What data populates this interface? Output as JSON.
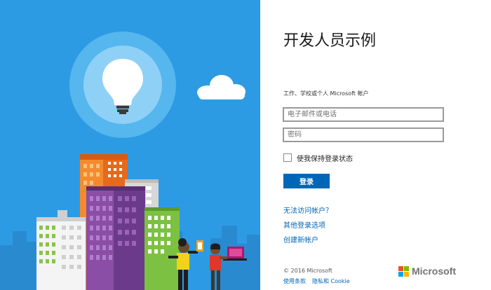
{
  "app": {
    "title": "开发人员示例"
  },
  "form": {
    "subtitle": "工作、学校或个人 Microsoft 帐户",
    "email_placeholder": "电子邮件或电话",
    "password_placeholder": "密码",
    "keep_signed_in_label": "使我保持登录状态",
    "sign_in_label": "登录"
  },
  "links": {
    "cant_access": "无法访问帐户？",
    "other_options": "其他登录选项",
    "create_account": "创建新帐户"
  },
  "footer": {
    "copyright": "© 2016 Microsoft",
    "terms": "使用条款",
    "privacy": "隐私和 Cookie",
    "logo_text": "Microsoft"
  },
  "colors": {
    "sky": "#2d9be3",
    "accent": "#0067b8",
    "logo_red": "#f25022",
    "logo_green": "#7fba00",
    "logo_blue": "#00a4ef",
    "logo_yellow": "#ffb900"
  },
  "icons": {
    "illustration": "lightbulb-city-illustration",
    "logo": "microsoft-logo-icon"
  }
}
